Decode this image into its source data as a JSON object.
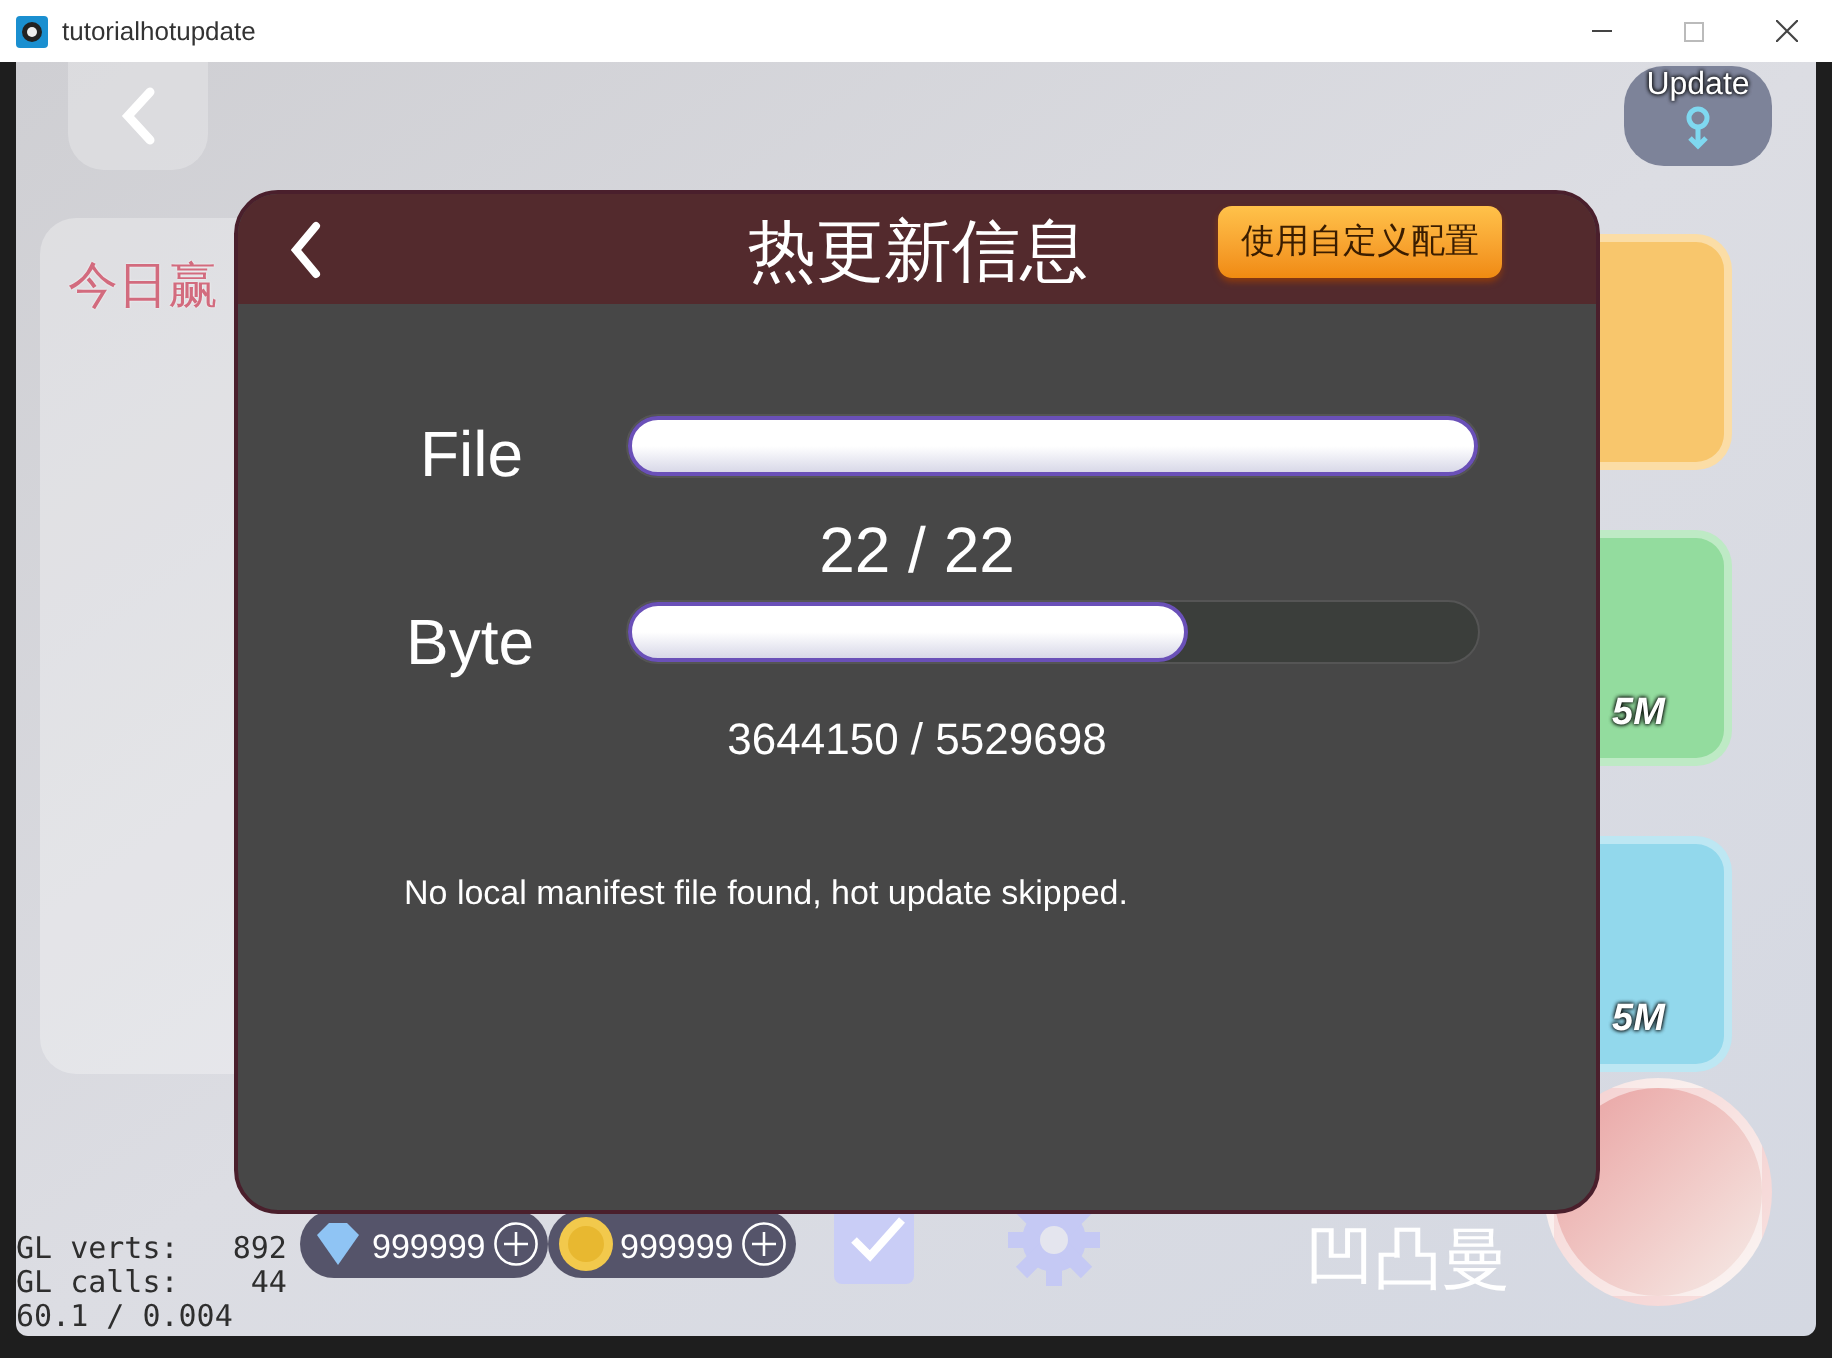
{
  "window": {
    "title": "tutorialhotupdate"
  },
  "scene": {
    "update_label": "Update",
    "today_label": "今日赢",
    "rooms": [
      {
        "color": "#f8c66c"
      },
      {
        "dealer": "5M",
        "color": "#93dc9e"
      },
      {
        "dealer": "5M",
        "color": "#92d8ec"
      }
    ],
    "currencies": [
      {
        "kind": "gem",
        "amount": "999999"
      },
      {
        "kind": "coin",
        "amount": "999999"
      }
    ],
    "player_name": "凹凸曼"
  },
  "dialog": {
    "title": "热更新信息",
    "custom_button": "使用自定义配置",
    "bars": [
      {
        "label": "File",
        "level": 1,
        "reading": "22 / 22"
      },
      {
        "label": "Byte",
        "level": 0.659,
        "reading": "3644150 / 5529698"
      }
    ],
    "message": "No local manifest file found, hot update skipped."
  },
  "stats": [
    "GL verts:   892",
    "GL calls:    44",
    "60.1 / 0.004"
  ]
}
